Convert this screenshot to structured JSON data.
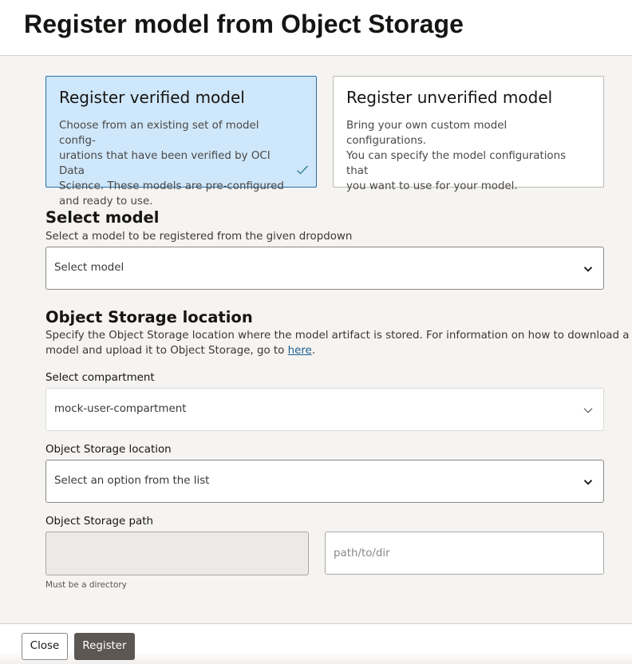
{
  "dialog": {
    "title": "Register model from Object Storage"
  },
  "cards": {
    "verified": {
      "title": "Register verified model",
      "description_lines": [
        "Choose from an existing set of model config-",
        "urations that have been verified by OCI Data",
        "Science. These models are pre-configured",
        "and ready to use."
      ],
      "selected": true,
      "check_icon": "checkmark-icon"
    },
    "unverified": {
      "title": "Register unverified model",
      "description_lines": [
        "Bring your own custom model configurations.",
        "You can specify the model configurations that",
        "you want to use for your model."
      ],
      "selected": false
    }
  },
  "select_model": {
    "heading": "Select model",
    "help": "Select a model to be registered from the given dropdown",
    "value": "Select model",
    "icon": "chevron-down-icon"
  },
  "object_storage": {
    "heading": "Object Storage location",
    "help_line1": "Specify the Object Storage location where the model artifact is stored. For information on how to download a",
    "help_line2_prefix": "model and upload it to Object Storage, go to ",
    "help_link": "here",
    "help_line2_suffix": "."
  },
  "compartment": {
    "label": "Select compartment",
    "value": "mock-user-compartment",
    "icon": "chevron-down-icon"
  },
  "location": {
    "label": "Object Storage location",
    "value": "Select an option from the list",
    "icon": "chevron-down-icon"
  },
  "path": {
    "label": "Object Storage path",
    "prefix_value": "",
    "placeholder": "path/to/dir",
    "hint": "Must be a directory"
  },
  "footer": {
    "close_label": "Close",
    "register_label": "Register"
  },
  "colors": {
    "selected_card_bg": "#cfe7fb",
    "selected_card_border": "#2a6ea3",
    "primary_button": "#5d5753",
    "link": "#1d5d8c"
  }
}
